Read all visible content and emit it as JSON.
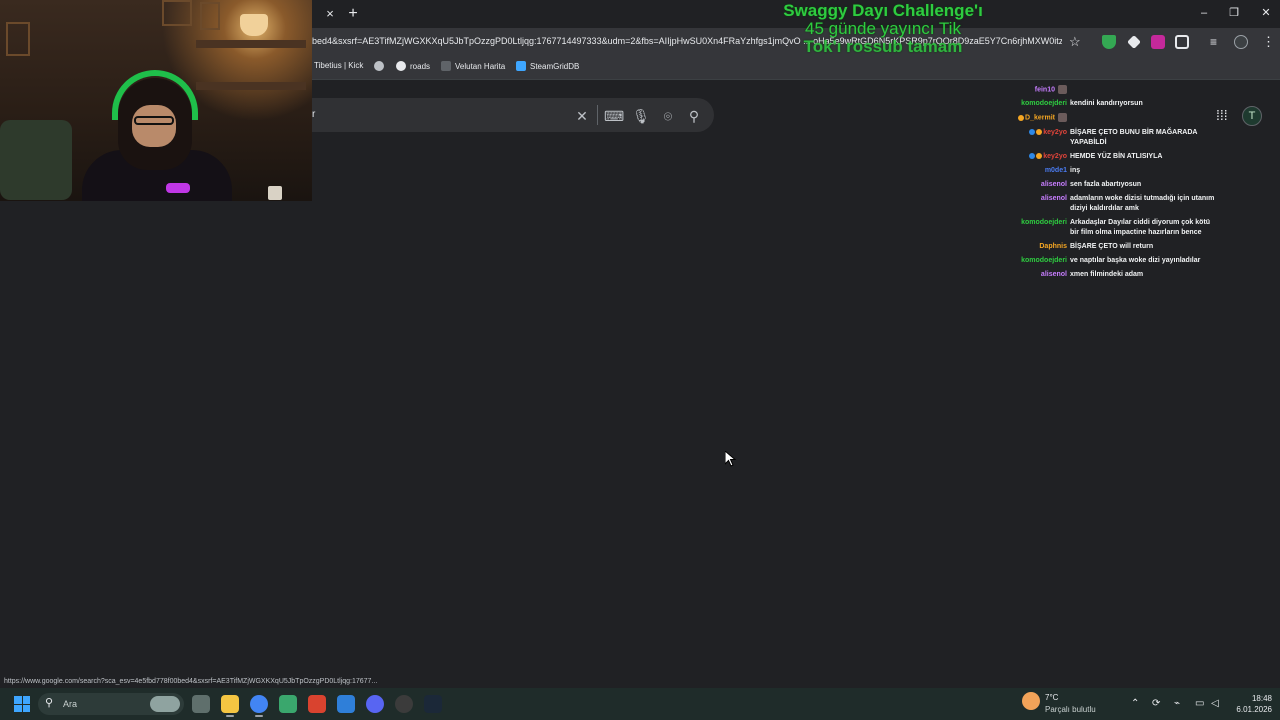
{
  "stream_overlay": {
    "title_line1": "Swaggy Dayı Challenge'ı",
    "title_line2": "45 günde yayıncı Tik",
    "title_line3": "Tok'ı rossub tamam"
  },
  "browser": {
    "tab_close_glyph": "×",
    "new_tab_glyph": "+",
    "window_controls": {
      "minimize": "–",
      "maximize": "❐",
      "close": "✕"
    },
    "url": "bed4&sxsrf=AE3TifMZjWGXKXqU5JbTpOzzgPD0Ltljqg:1767714497333&udm=2&fbs=AIIjpHwSU0Xn4FRaYzhfgs1jmQvO ... oHa5e9wRtGD6N5rKPSR9p7rQOr8D9zaE5Y7Cn6rjhMXW0itz-18SR4",
    "bookmarks": [
      {
        "label": "Tibetius | Kick",
        "icon": "kick-icon"
      },
      {
        "label": "",
        "icon": "globe-icon"
      },
      {
        "label": "roads",
        "icon": "roads-icon"
      },
      {
        "label": "Velutan Harita",
        "icon": "map-icon"
      },
      {
        "label": "SteamGridDB",
        "icon": "steamgriddb-icon"
      }
    ],
    "status_url": "https://www.google.com/search?sca_esv=4e5fbd778f00bed4&sxsrf=AE3TifMZjWGXKXqU5JbTpOzzgPD0Ltljqg:17677..."
  },
  "google": {
    "search_value": "r",
    "clear_glyph": "✕",
    "apps_glyph": "⋮⋮⋮",
    "profile_initial": "T"
  },
  "chat": [
    {
      "user": "fein10",
      "color": "#c77dff",
      "badges": [],
      "message": "",
      "emote": true
    },
    {
      "user": "komodoejderi",
      "color": "#2ecc40",
      "badges": [],
      "message": "kendini kandırıyorsun"
    },
    {
      "user": "D_kermit",
      "color": "#f5a623",
      "badges": [
        "orange"
      ],
      "message": "",
      "emote": true
    },
    {
      "user": "key2yo",
      "color": "#e0443a",
      "badges": [
        "blue",
        "orange"
      ],
      "message": "BİŞARE ÇETO BUNU BİR MAĞARADA YAPABİLDİ"
    },
    {
      "user": "key2yo",
      "color": "#e0443a",
      "badges": [
        "blue",
        "orange"
      ],
      "message": "HEMDE YÜZ BİN ATLISIYLA"
    },
    {
      "user": "m0de1",
      "color": "#4a7bf0",
      "badges": [],
      "message": "inş"
    },
    {
      "user": "alisenol",
      "color": "#c77dff",
      "badges": [],
      "message": "sen fazla abartıyosun"
    },
    {
      "user": "alisenol",
      "color": "#c77dff",
      "badges": [],
      "message": "adamların woke dizisi tutmadığı için utanım diziyi kaldırdılar amk"
    },
    {
      "user": "komodoejderi",
      "color": "#2ecc40",
      "badges": [],
      "message": "Arkadaşlar Dayılar ciddi diyorum çok kötü bir film olma impactine hazırların bence"
    },
    {
      "user": "Daphnis",
      "color": "#f5a623",
      "badges": [],
      "message": "BİŞARE ÇETO will return"
    },
    {
      "user": "komodoejderi",
      "color": "#2ecc40",
      "badges": [],
      "message": "ve naptılar başka woke dizi yayınladılar"
    },
    {
      "user": "alisenol",
      "color": "#c77dff",
      "badges": [],
      "message": "xmen filmindeki adam"
    }
  ],
  "taskbar": {
    "search_placeholder": "Ara",
    "weather_temp": "7°C",
    "weather_condition": "Parçalı bulutlu",
    "time": "18:48",
    "date": "6.01.2026",
    "apps": [
      {
        "name": "task-view-icon",
        "color": "#5f6f6c"
      },
      {
        "name": "file-explorer-icon",
        "color": "#f4c542"
      },
      {
        "name": "chrome-icon",
        "color": "#4285f4"
      },
      {
        "name": "app-green-icon",
        "color": "#3aa76d"
      },
      {
        "name": "app-red-icon",
        "color": "#d9432f"
      },
      {
        "name": "app-blue-icon",
        "color": "#2f7fd9"
      },
      {
        "name": "discord-icon",
        "color": "#5865f2"
      },
      {
        "name": "app-dark-icon",
        "color": "#3b3b3b"
      },
      {
        "name": "steam-icon",
        "color": "#1b2838"
      }
    ]
  },
  "colors": {
    "accent_green": "#2ecc40",
    "background": "#202124",
    "taskbar": "#1f2c2a"
  }
}
